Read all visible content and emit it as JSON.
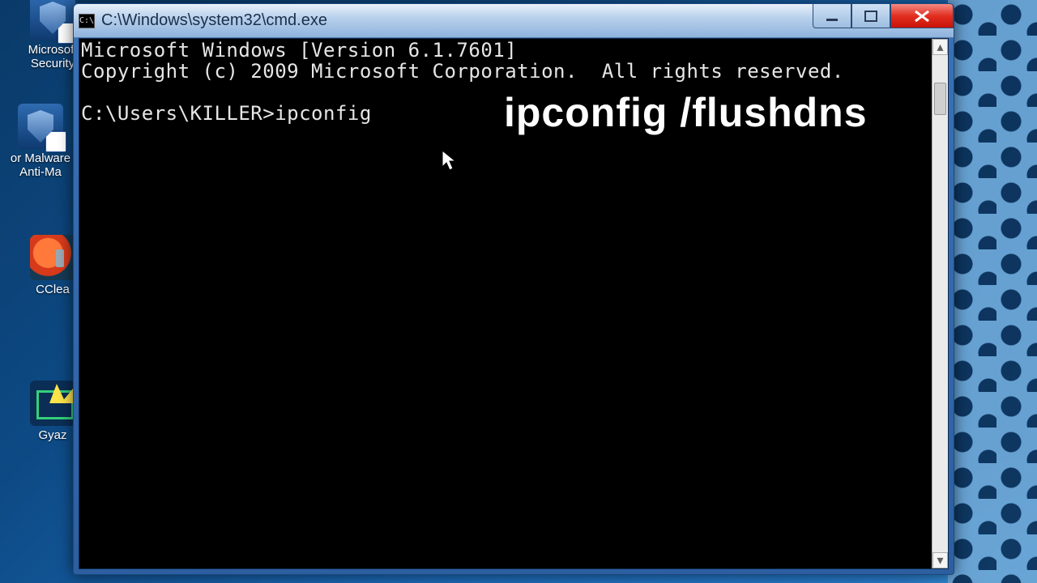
{
  "desktop": {
    "icons": [
      {
        "label_line1": "Microsoft",
        "label_line2": "Security",
        "icon": "shield"
      },
      {
        "label_line1": "or Malware",
        "label_line2": "Anti-Ma",
        "icon": "shield"
      },
      {
        "label_line1": "CClea",
        "label_line2": "",
        "icon": "ccleaner"
      },
      {
        "label_line1": "Gyaz",
        "label_line2": "",
        "icon": "gyazo"
      }
    ]
  },
  "window": {
    "title": "C:\\Windows\\system32\\cmd.exe",
    "appicon_glyph": "C:\\"
  },
  "terminal": {
    "line1": "Microsoft Windows [Version 6.1.7601]",
    "line2": "Copyright (c) 2009 Microsoft Corporation.  All rights reserved.",
    "blank": "",
    "prompt": "C:\\Users\\KILLER>",
    "command": "ipconfig"
  },
  "overlay": {
    "text": "ipconfig /flushdns"
  },
  "scrollbar": {
    "up": "▴",
    "down": "▾"
  }
}
